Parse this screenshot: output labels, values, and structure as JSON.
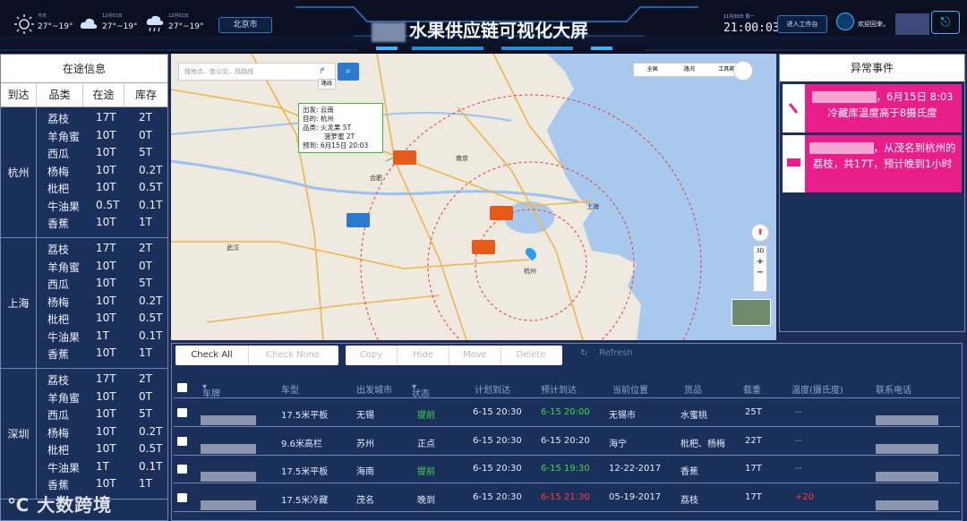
{
  "header": {
    "title": "水果供应链可视化大屏",
    "weather": [
      {
        "date": "今天",
        "temp": "27°~19°",
        "icon": "sun-icon"
      },
      {
        "date": "12月01日",
        "temp": "27°~19°",
        "icon": "cloud-icon"
      },
      {
        "date": "12月01日",
        "temp": "27°~19°",
        "icon": "rain-icon"
      }
    ],
    "city": "北京市",
    "date_line": "11月30日 周一",
    "time": "21:00:03",
    "workbench_label": "进入工作台",
    "welcome": "欢迎回来，"
  },
  "left_panel": {
    "title": "在途信息",
    "columns": [
      "到达",
      "品类",
      "在途",
      "库存"
    ],
    "groups": [
      {
        "city": "杭州",
        "rows": [
          {
            "cat": "荔枝",
            "transit": "17T",
            "stock": "2T"
          },
          {
            "cat": "羊角蜜",
            "transit": "10T",
            "stock": "0T"
          },
          {
            "cat": "西瓜",
            "transit": "10T",
            "stock": "5T"
          },
          {
            "cat": "杨梅",
            "transit": "10T",
            "stock": "0.2T"
          },
          {
            "cat": "枇杷",
            "transit": "10T",
            "stock": "0.5T"
          },
          {
            "cat": "牛油果",
            "transit": "0.5T",
            "stock": "0.1T"
          },
          {
            "cat": "香蕉",
            "transit": "10T",
            "stock": "1T"
          }
        ]
      },
      {
        "city": "上海",
        "rows": [
          {
            "cat": "荔枝",
            "transit": "17T",
            "stock": "2T"
          },
          {
            "cat": "羊角蜜",
            "transit": "10T",
            "stock": "0T"
          },
          {
            "cat": "西瓜",
            "transit": "10T",
            "stock": "5T"
          },
          {
            "cat": "杨梅",
            "transit": "10T",
            "stock": "0.2T"
          },
          {
            "cat": "枇杷",
            "transit": "10T",
            "stock": "0.5T"
          },
          {
            "cat": "牛油果",
            "transit": "1T",
            "stock": "0.1T"
          },
          {
            "cat": "香蕉",
            "transit": "10T",
            "stock": "1T"
          }
        ]
      },
      {
        "city": "深圳",
        "rows": [
          {
            "cat": "荔枝",
            "transit": "17T",
            "stock": "2T"
          },
          {
            "cat": "羊角蜜",
            "transit": "10T",
            "stock": "0T"
          },
          {
            "cat": "西瓜",
            "transit": "10T",
            "stock": "5T"
          },
          {
            "cat": "杨梅",
            "transit": "10T",
            "stock": "0.2T"
          },
          {
            "cat": "枇杷",
            "transit": "10T",
            "stock": "0.5T"
          },
          {
            "cat": "牛油果",
            "transit": "1T",
            "stock": "0.1T"
          },
          {
            "cat": "香蕉",
            "transit": "10T",
            "stock": "1T"
          }
        ]
      }
    ]
  },
  "map": {
    "search_placeholder": "搜地点、查公交、找路线",
    "route_label": "路线",
    "toolbar": [
      "全国",
      "路况",
      "工具箱"
    ],
    "popup": [
      "出发: 云南",
      "目的: 杭州",
      "品类: 火龙果 5T",
      "菠萝蜜 2T",
      "预到: 6月15日 20:03"
    ],
    "labels": [
      "南京",
      "合肥",
      "上海",
      "武汉",
      "杭州"
    ],
    "controls": [
      "3D",
      "+",
      "−"
    ]
  },
  "right_panel": {
    "title": "异常事件",
    "events": [
      {
        "icon": "thermometer-icon",
        "text": "，6月15日 8:03 冷藏库温度高于8摄氏度"
      },
      {
        "icon": "truck-icon",
        "text": "，从茂名到杭州的荔枝，共17T，预计晚到1小时"
      }
    ]
  },
  "table": {
    "toolbar_left": [
      "Check All",
      "Check None"
    ],
    "toolbar_mid": [
      "Copy",
      "Hide",
      "Move",
      "Delete"
    ],
    "refresh_label": "Refresh",
    "headers": [
      "车牌",
      "车型",
      "出发城市",
      "状态",
      "计划到达",
      "预计到达",
      "当前位置",
      "货品",
      "载重",
      "温度(摄氏度)",
      "联系电话"
    ],
    "rows": [
      {
        "type": "17.5米平板",
        "from": "无锡",
        "status": "提前",
        "plan": "6-15 20:30",
        "eta": "6-15 20:00",
        "pos": "无锡市",
        "goods": "水蜜桃",
        "load": "25T",
        "temp": "--"
      },
      {
        "type": "9.6米高栏",
        "from": "苏州",
        "status": "正点",
        "plan": "6-15 20:30",
        "eta": "6-15 20:20",
        "pos": "海宁",
        "goods": "枇杷、杨梅",
        "load": "22T",
        "temp": "--"
      },
      {
        "type": "17.5米平板",
        "from": "海南",
        "status": "提前",
        "plan": "6-15 20:30",
        "eta": "6-15 19:30",
        "pos": "12-22-2017",
        "goods": "香蕉",
        "load": "17T",
        "temp": "--"
      },
      {
        "type": "17.5米冷藏",
        "from": "茂名",
        "status": "晚到",
        "plan": "6-15 20:30",
        "eta": "6-15 21:30",
        "pos": "05-19-2017",
        "goods": "荔枝",
        "load": "17T",
        "temp": "+20"
      }
    ]
  },
  "watermark": "大数跨境",
  "colors": {
    "accent": "#38b6ff",
    "alert": "#ea1e8a",
    "early": "#42d842",
    "late": "#ff3b3b"
  }
}
